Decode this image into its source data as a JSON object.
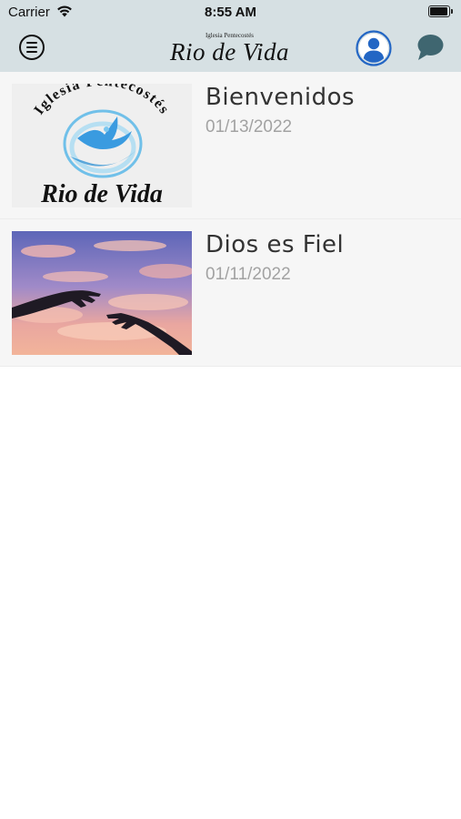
{
  "status_bar": {
    "carrier": "Carrier",
    "time": "8:55 AM"
  },
  "header": {
    "brand_subtitle": "Iglesia Pentecostés",
    "brand_title": "Rio de Vida",
    "menu_icon": "hamburger-menu-icon",
    "profile_icon": "user-profile-icon",
    "chat_icon": "chat-bubble-icon"
  },
  "feed": {
    "items": [
      {
        "title": "Bienvenidos",
        "date": "01/13/2022",
        "image": {
          "arc_text": "Iglesia Pentecostés",
          "script_text": "Rio de Vida",
          "icon": "dove-water-logo"
        }
      },
      {
        "title": "Dios es Fiel",
        "date": "01/11/2022",
        "image": {
          "description_icon": "reaching-hands-sunset"
        }
      }
    ]
  },
  "colors": {
    "header_bg": "#d6e0e3",
    "profile_accent": "#2366c4",
    "chat_icon": "#3f6670",
    "list_bg": "#f6f6f6",
    "date_text": "#a2a2a2"
  }
}
